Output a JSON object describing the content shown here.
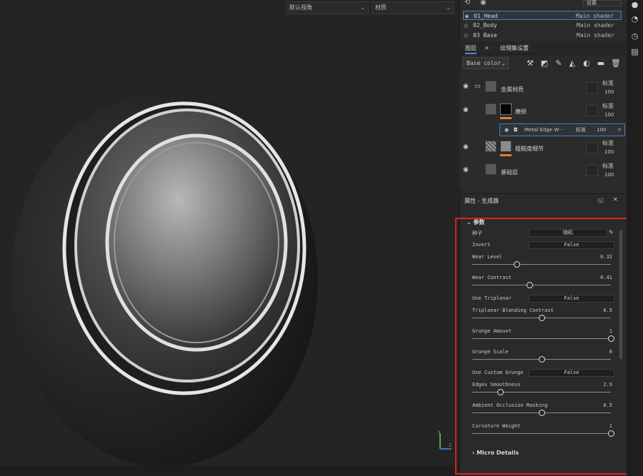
{
  "viewport": {
    "camera_select": "默认视角",
    "material_select": "材质"
  },
  "texture_sets": {
    "settings_select": "设置",
    "rows": [
      {
        "name": "01_Head",
        "shader": "Main shader",
        "selected": true
      },
      {
        "name": "02_Body",
        "shader": "Main shader",
        "selected": false
      },
      {
        "name": "03_Base",
        "shader": "Main shader",
        "selected": false
      }
    ]
  },
  "tabs": {
    "layers": "图层",
    "texture_set_settings": "纹理集设置"
  },
  "toolbar": {
    "channel": "Base color"
  },
  "layers": [
    {
      "name": "金属材质",
      "blend": "标准",
      "opacity": "100"
    },
    {
      "name": "磨损",
      "blend": "标准",
      "opacity": "100"
    },
    {
      "name": "粗糙度细节",
      "blend": "标准",
      "opacity": "100"
    },
    {
      "name": "基础层",
      "blend": "标准",
      "opacity": "100"
    }
  ],
  "sublayer": {
    "name": "Metal Edge W···",
    "blend": "标准",
    "opacity": "100"
  },
  "properties": {
    "title": "属性 - 生成器",
    "section": "参数",
    "seed_label": "种子",
    "seed_button": "随机",
    "params": [
      {
        "label": "Invert",
        "type": "field",
        "value": "False"
      },
      {
        "label": "Wear Level",
        "type": "slider",
        "value": "0.32",
        "level": 0.32
      },
      {
        "label": "Wear Contrast",
        "type": "slider",
        "value": "0.41",
        "level": 0.41
      },
      {
        "label": "Use Triplanar",
        "type": "field",
        "value": "False"
      },
      {
        "label": "Triplanar Blending Contrast",
        "type": "slider",
        "value": "0.5",
        "level": 0.5
      },
      {
        "label": "Grunge Amount",
        "type": "slider",
        "value": "1",
        "level": 1.0
      },
      {
        "label": "Grunge Scale",
        "type": "slider",
        "value": "8",
        "level": 0.5
      },
      {
        "label": "Use Custom Grunge",
        "type": "field",
        "value": "False"
      },
      {
        "label": "Edges Smoothness",
        "type": "slider",
        "value": "2.9",
        "level": 0.2
      },
      {
        "label": "Ambient Occlusion Masking",
        "type": "slider",
        "value": "0.5",
        "level": 0.5
      },
      {
        "label": "Curvature Weight",
        "type": "slider",
        "value": "1",
        "level": 1.0
      }
    ],
    "micro_details": "Micro Details"
  },
  "colors": {
    "accent": "#4a90d9",
    "highlight_box": "#e02020",
    "mask_bar": "#e0822a"
  }
}
